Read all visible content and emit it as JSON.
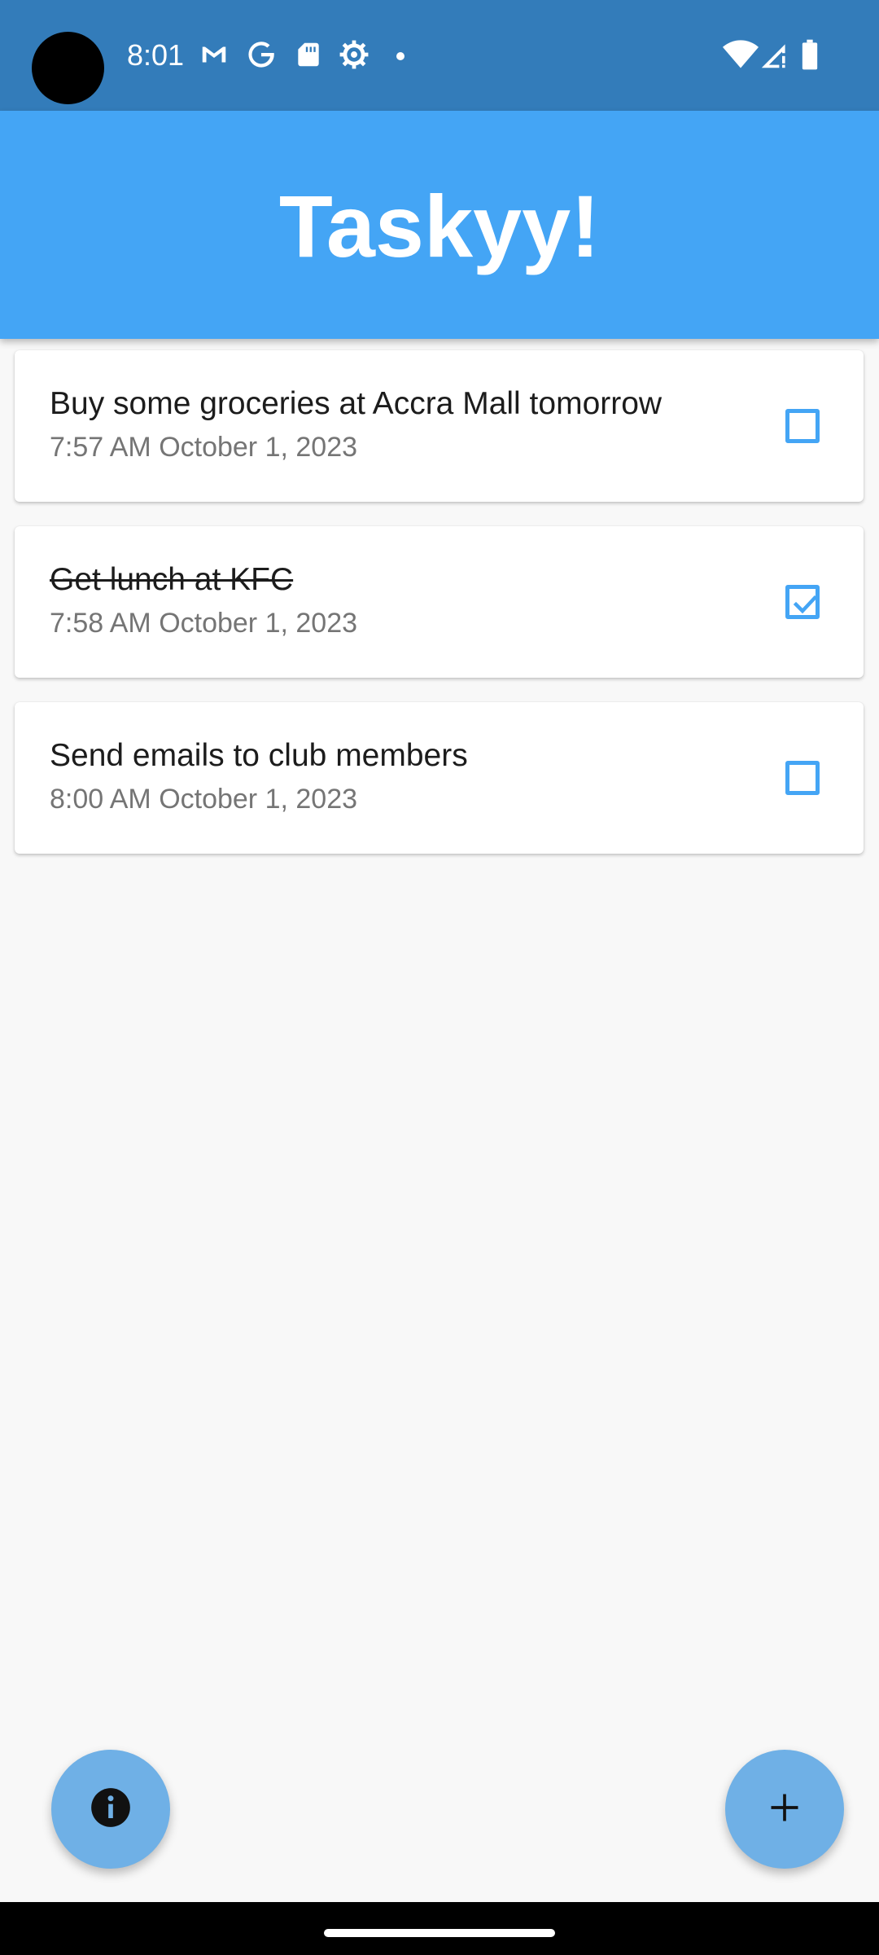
{
  "status_bar": {
    "time": "8:01",
    "left_icons": [
      "gmail-icon",
      "google-icon",
      "sd-card-icon",
      "settings-gear-icon",
      "dot-icon"
    ],
    "right_icons": [
      "wifi-icon",
      "cell-signal-icon",
      "battery-icon"
    ]
  },
  "app_bar": {
    "title": "Taskyy!"
  },
  "tasks": [
    {
      "title": "Buy some groceries at Accra Mall tomorrow",
      "time": "7:57 AM October 1, 2023",
      "done": false
    },
    {
      "title": "Get lunch at KFC",
      "time": "7:58 AM October 1, 2023",
      "done": true
    },
    {
      "title": "Send emails to club members",
      "time": "8:00 AM October 1, 2023",
      "done": false
    }
  ],
  "fabs": {
    "info_icon": "info-icon",
    "add_icon": "plus-icon"
  },
  "colors": {
    "accent": "#44a5f5",
    "status_bar": "#337cba",
    "fab": "#6fb0e6"
  }
}
